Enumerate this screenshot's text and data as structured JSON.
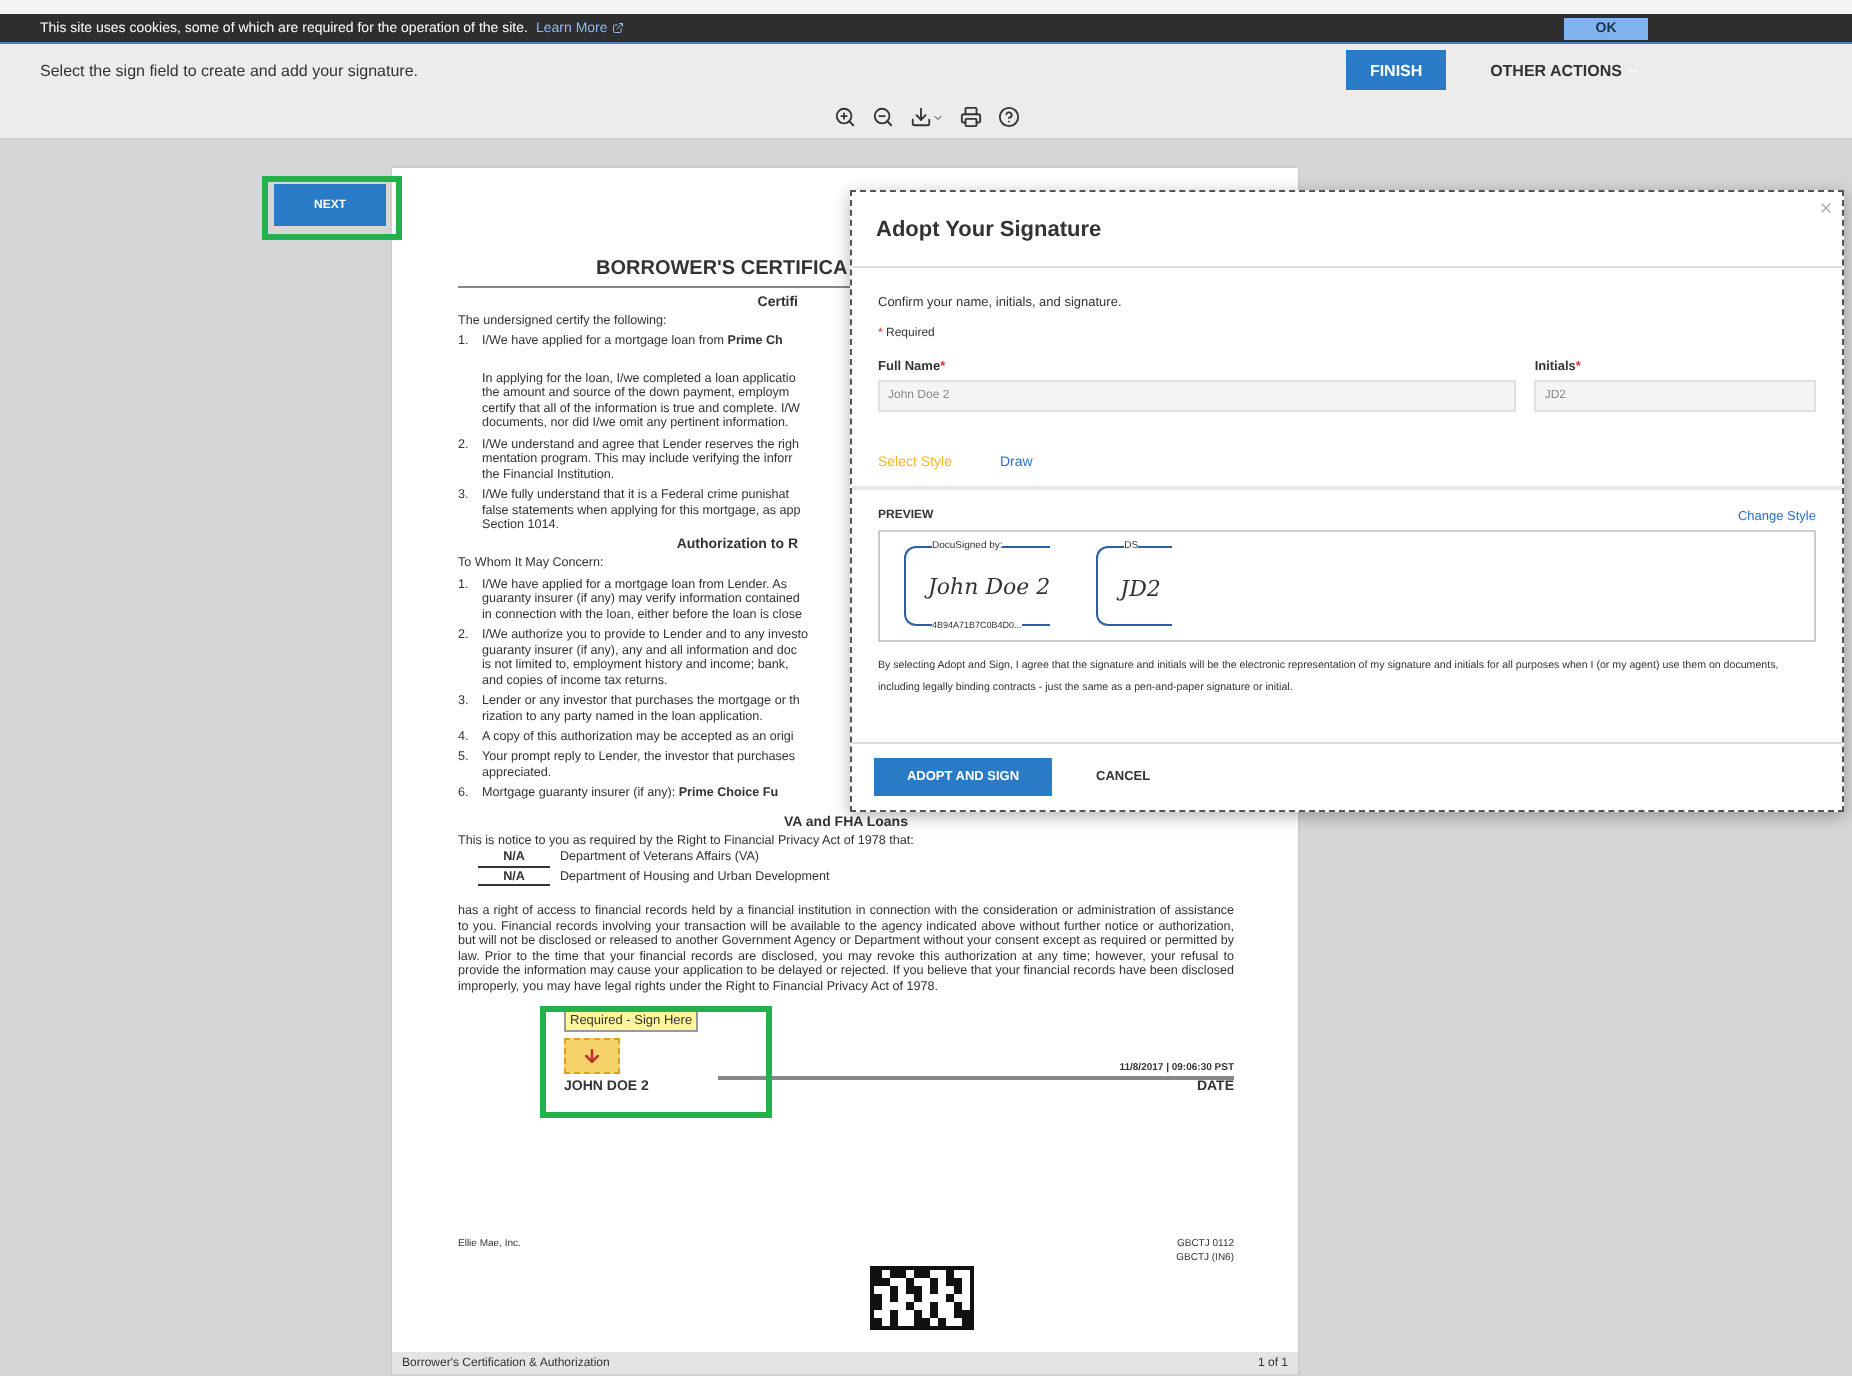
{
  "cookie_bar": {
    "text": "This site uses cookies, some of which are required for the operation of the site.",
    "link": "Learn More",
    "button": "OK"
  },
  "action_bar": {
    "instruction": "Select the sign field to create and add your signature.",
    "finish": "FINISH",
    "other_actions": "OTHER ACTIONS"
  },
  "next_button": "NEXT",
  "document": {
    "lines": [
      {
        "kind": "title",
        "text": "BORROWER'S CERTIFICA"
      },
      {
        "kind": "subhead",
        "text": "Certifi"
      },
      {
        "kind": "para",
        "text": "The undersigned certify the following:"
      },
      {
        "kind": "item",
        "num": "1.",
        "text": "I/We have applied for a mortgage loan from    **Prime Ch**"
      },
      {
        "kind": "spacer"
      },
      {
        "kind": "cont",
        "text": "In applying for the loan, I/we completed a loan applicatio"
      },
      {
        "kind": "cont",
        "text": "the amount and source of the down payment, employm"
      },
      {
        "kind": "cont",
        "text": "certify that all of the information is true and complete. I/W"
      },
      {
        "kind": "cont",
        "text": "documents, nor did I/we omit any pertinent information."
      },
      {
        "kind": "item",
        "num": "2.",
        "text": "I/We understand and agree that Lender reserves the righ"
      },
      {
        "kind": "cont",
        "text": "mentation program. This may include verifying the inforr"
      },
      {
        "kind": "cont",
        "text": "the Financial Institution."
      },
      {
        "kind": "item",
        "num": "3.",
        "text": "I/We fully understand that it is a Federal crime punishat"
      },
      {
        "kind": "cont",
        "text": "false statements when applying for this mortgage, as app"
      },
      {
        "kind": "cont",
        "text": "Section 1014."
      },
      {
        "kind": "subhead",
        "text": "Authorization to R"
      },
      {
        "kind": "para",
        "text": "To Whom It May Concern:"
      },
      {
        "kind": "item",
        "num": "1.",
        "text": "I/We have applied for a mortgage loan from Lender. As"
      },
      {
        "kind": "cont",
        "text": "guaranty insurer (if any) may verify information contained"
      },
      {
        "kind": "cont",
        "text": "in connection with the loan, either before the loan is close"
      },
      {
        "kind": "item",
        "num": "2.",
        "text": "I/We authorize you to provide to Lender and to any investo"
      },
      {
        "kind": "cont",
        "text": "guaranty insurer (if any), any and all information and doc"
      },
      {
        "kind": "cont",
        "text": "is not limited to, employment history and income; bank,"
      },
      {
        "kind": "cont",
        "text": "and copies of income tax returns."
      },
      {
        "kind": "item",
        "num": "3.",
        "text": "Lender or any investor that purchases the mortgage or th"
      },
      {
        "kind": "cont",
        "text": "rization to any party named in the loan application."
      },
      {
        "kind": "item",
        "num": "4.",
        "text": "A copy of this authorization may be accepted as an origi"
      },
      {
        "kind": "item",
        "num": "5.",
        "text": "Your prompt reply to Lender, the investor that purchases"
      },
      {
        "kind": "cont",
        "text": "appreciated."
      },
      {
        "kind": "item",
        "num": "6.",
        "text": "Mortgage guaranty insurer (if any):    **Prime Choice Fu**"
      },
      {
        "kind": "center",
        "text": "VA and FHA Loans"
      },
      {
        "kind": "para",
        "text": "This is notice to you as required by the Right to Financial Privacy Act of 1978 that:"
      },
      {
        "kind": "agency",
        "num": "N/A",
        "text": "Department of Veterans Affairs (VA)"
      },
      {
        "kind": "agency",
        "num": "N/A",
        "text": "Department of Housing and Urban Development"
      },
      {
        "kind": "block",
        "text": "has a right of access to financial records held by a financial institution in connection with the consideration or administration of assistance to you. Financial records involving your transaction will be available to the agency indicated above without further notice or authorization, but will not be disclosed or released to another Government Agency or Department without your consent except as required or permitted by law. Prior to the time that your financial records are disclosed, you may revoke this authorization at any time; however, your refusal to provide the information may cause your application to be delayed or rejected. If you believe that your financial records have been disclosed improperly, you may have legal rights under the Right to Financial Privacy Act of 1978."
      }
    ],
    "sign_tag": "Required - Sign Here",
    "signer": "JOHN DOE 2",
    "timestamp": "11/8/2017 | 09:06:30 PST",
    "date_label": "DATE",
    "company": "Ellie Mae, Inc.",
    "form_codes": [
      "GBCTJ  0112",
      "GBCTJ (IN6)"
    ],
    "footer_title": "Borrower's Certification & Authorization",
    "page_count": "1 of 1"
  },
  "modal": {
    "title": "Adopt Your Signature",
    "intro": "Confirm your name, initials, and signature.",
    "required_mark": "*",
    "required_note": "Required",
    "fields": [
      {
        "label": "Full Name",
        "value": "John Doe 2"
      },
      {
        "label": "Initials",
        "value": "JD2"
      }
    ],
    "tabs": [
      {
        "label": "Select Style",
        "selected": true
      },
      {
        "label": "Draw",
        "selected": false
      }
    ],
    "preview_label": "PREVIEW",
    "change_style": "Change Style",
    "signature": {
      "caption": "DocuSigned by:",
      "name": "John Doe 2",
      "hash": "4B94A71B7C0B4D0..."
    },
    "initials": {
      "caption": "DS",
      "name": "JD2"
    },
    "legal": "By selecting Adopt and Sign, I agree that the signature and initials will be the electronic representation of my signature and initials for all purposes when I (or my agent) use them on documents, including legally binding contracts - just the same as a pen-and-paper signature or initial.",
    "buttons": [
      "ADOPT AND SIGN",
      "CANCEL"
    ]
  }
}
